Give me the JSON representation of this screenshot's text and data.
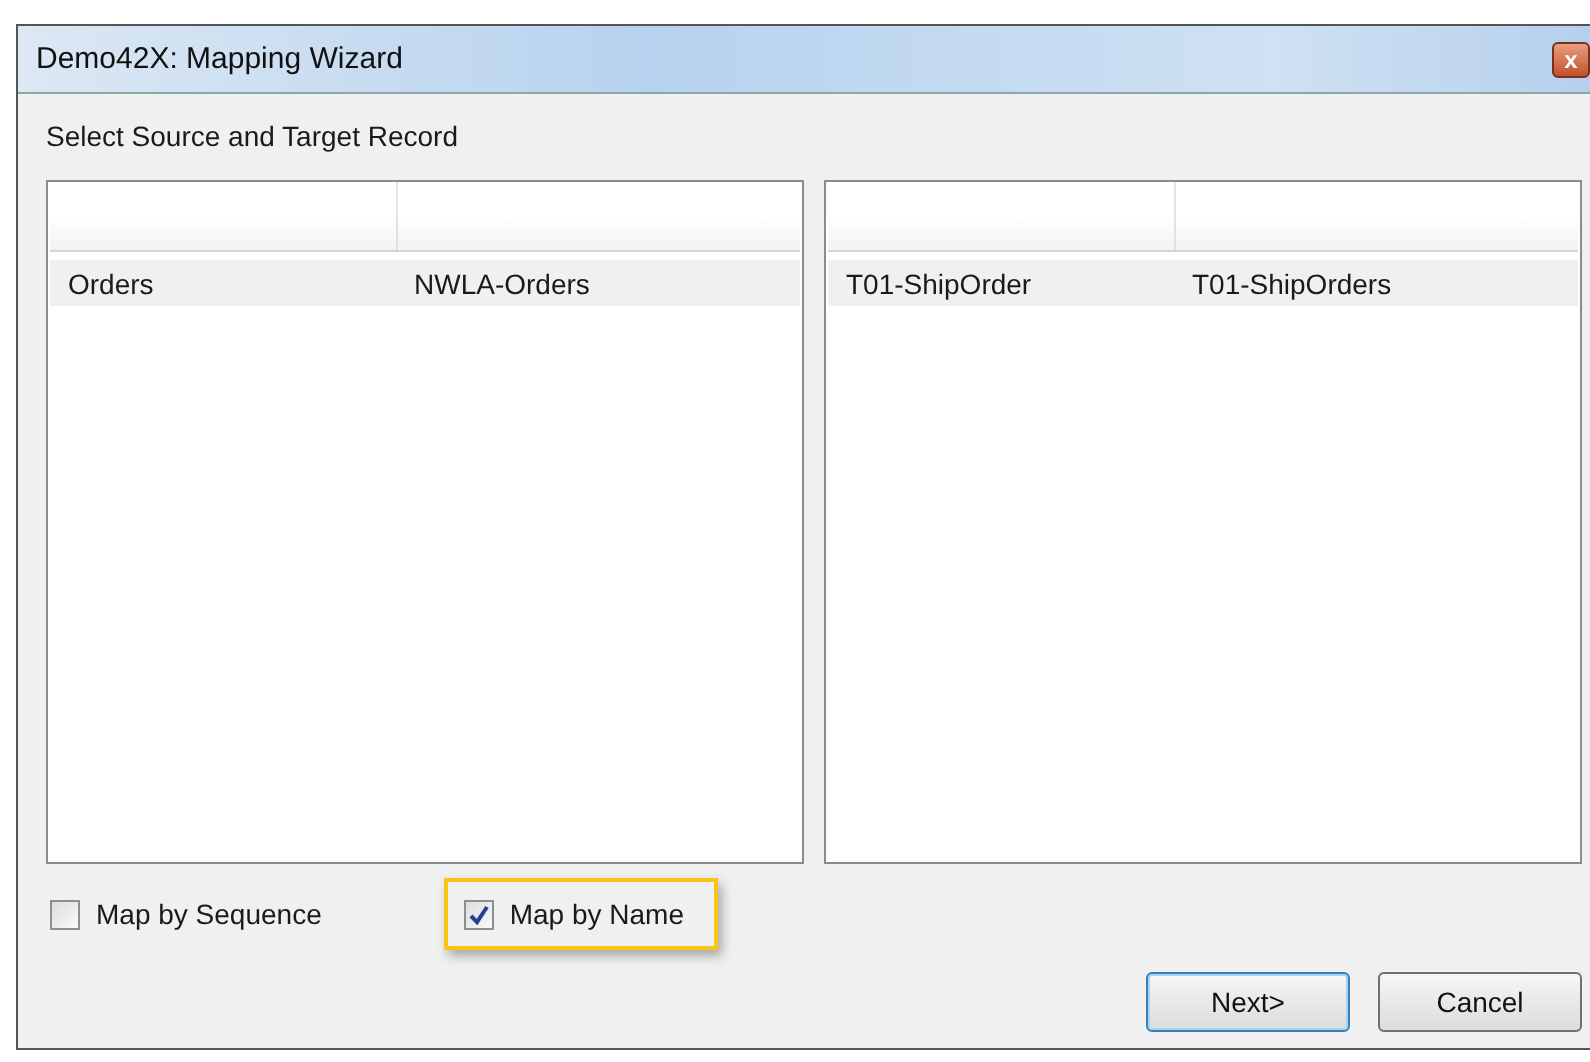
{
  "window": {
    "title": "Demo42X: Mapping Wizard",
    "close_label": "x"
  },
  "instruction": "Select Source and Target Record",
  "lists": [
    {
      "rows": [
        {
          "cells": [
            "Orders",
            "NWLA-Orders"
          ],
          "selected": true
        }
      ]
    },
    {
      "rows": [
        {
          "cells": [
            "T01-ShipOrder",
            "T01-ShipOrders"
          ],
          "selected": true
        }
      ]
    }
  ],
  "options": [
    {
      "label": "Map by Sequence",
      "checked": false,
      "highlighted": false
    },
    {
      "label": "Map by Name",
      "checked": true,
      "highlighted": true
    }
  ],
  "buttons": [
    {
      "label": "Next>",
      "default": true
    },
    {
      "label": "Cancel",
      "default": false
    }
  ]
}
